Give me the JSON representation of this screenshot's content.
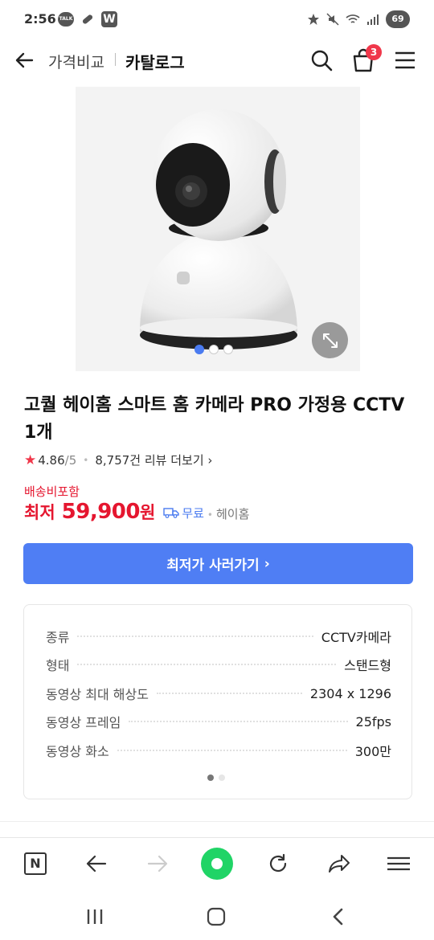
{
  "status_bar": {
    "time": "2:56",
    "talk_label": "TALK",
    "w_label": "W",
    "battery": "69"
  },
  "nav": {
    "crumb_1": "가격비교",
    "crumb_2": "카탈로그",
    "cart_count": "3"
  },
  "product": {
    "title": "고퀄 헤이홈 스마트 홈 카메라 PRO 가정용 CCTV 1개",
    "rating": "4.86",
    "rating_max": "/5",
    "reviews": "8,757건 리뷰 더보기",
    "shipping_label": "배송비포함",
    "price_prefix": "최저",
    "price": "59,900",
    "price_unit": "원",
    "free_shipping": "무료",
    "seller": "헤이홈",
    "image_page": 1,
    "image_pages": 3
  },
  "buy_button": {
    "label": "최저가 사러가기"
  },
  "specs": [
    {
      "key": "종류",
      "value": "CCTV카메라"
    },
    {
      "key": "형태",
      "value": "스탠드형"
    },
    {
      "key": "동영상 최대 해상도",
      "value": "2304 x 1296"
    },
    {
      "key": "동영상 프레임",
      "value": "25fps"
    },
    {
      "key": "동영상 화소",
      "value": "300만"
    }
  ],
  "spec_page": 1,
  "spec_pages": 2,
  "colors": {
    "accent_blue": "#4f7ef4",
    "price_red": "#e5162f",
    "badge_red": "#f0374a",
    "naver_green": "#20d466"
  }
}
